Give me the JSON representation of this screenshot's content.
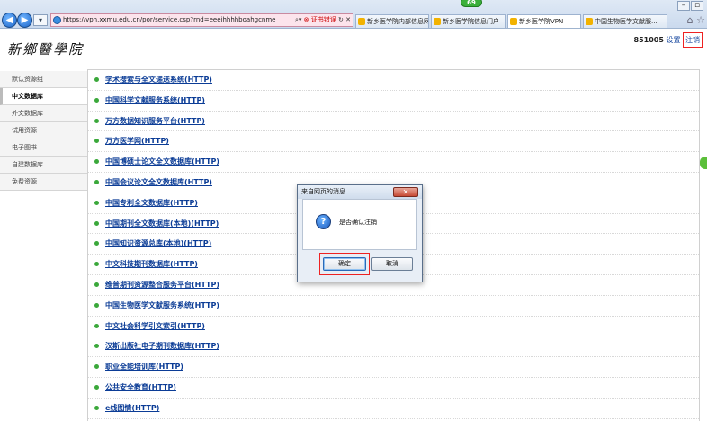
{
  "browser": {
    "url": "https://vpn.xxmu.edu.cn/por/service.csp?rnd=eeeihhhhboahgcnme",
    "cert_error": "证书错误",
    "tabs": [
      {
        "label": "新乡医学院内部信息网"
      },
      {
        "label": "新乡医学院信息门户"
      },
      {
        "label": "新乡医学院VPN"
      },
      {
        "label": "中国生物医学文献服..."
      }
    ],
    "active_tab": 2,
    "notification_badge": "69"
  },
  "header": {
    "logo_text": "新鄉醫學院",
    "user_id": "851005",
    "settings_label": "设置",
    "logout_label": "注销"
  },
  "sidebar": {
    "items": [
      {
        "label": "默认资源组"
      },
      {
        "label": "中文数据库"
      },
      {
        "label": "外文数据库"
      },
      {
        "label": "试用资源"
      },
      {
        "label": "电子图书"
      },
      {
        "label": "自建数据库"
      },
      {
        "label": "免费资源"
      }
    ],
    "active_index": 1
  },
  "resources": [
    {
      "label": "学术搜索与全文递送系统(HTTP)"
    },
    {
      "label": "中国科学文献服务系统(HTTP)"
    },
    {
      "label": "万方数据知识服务平台(HTTP)"
    },
    {
      "label": "万方医学网(HTTP)"
    },
    {
      "label": "中国博硕士论文全文数据库(HTTP)"
    },
    {
      "label": "中国会议论文全文数据库(HTTP)"
    },
    {
      "label": "中国专利全文数据库(HTTP)"
    },
    {
      "label": "中国期刊全文数据库(本地)(HTTP)"
    },
    {
      "label": "中国知识资源总库(本地)(HTTP)"
    },
    {
      "label": "中文科技期刊数据库(HTTP)"
    },
    {
      "label": "维普期刊资源整合服务平台(HTTP)"
    },
    {
      "label": "中国生物医学文献服务系统(HTTP)"
    },
    {
      "label": "中文社会科学引文索引(HTTP)"
    },
    {
      "label": "汉斯出版社电子期刊数据库(HTTP)"
    },
    {
      "label": "职业全能培训库(HTTP)"
    },
    {
      "label": "公共安全教育(HTTP)"
    },
    {
      "label": "e线图情(HTTP)"
    }
  ],
  "dialog": {
    "title": "来自网页的消息",
    "message": "是否确认注销",
    "ok_label": "确定",
    "cancel_label": "取消",
    "icon": "question-icon"
  }
}
